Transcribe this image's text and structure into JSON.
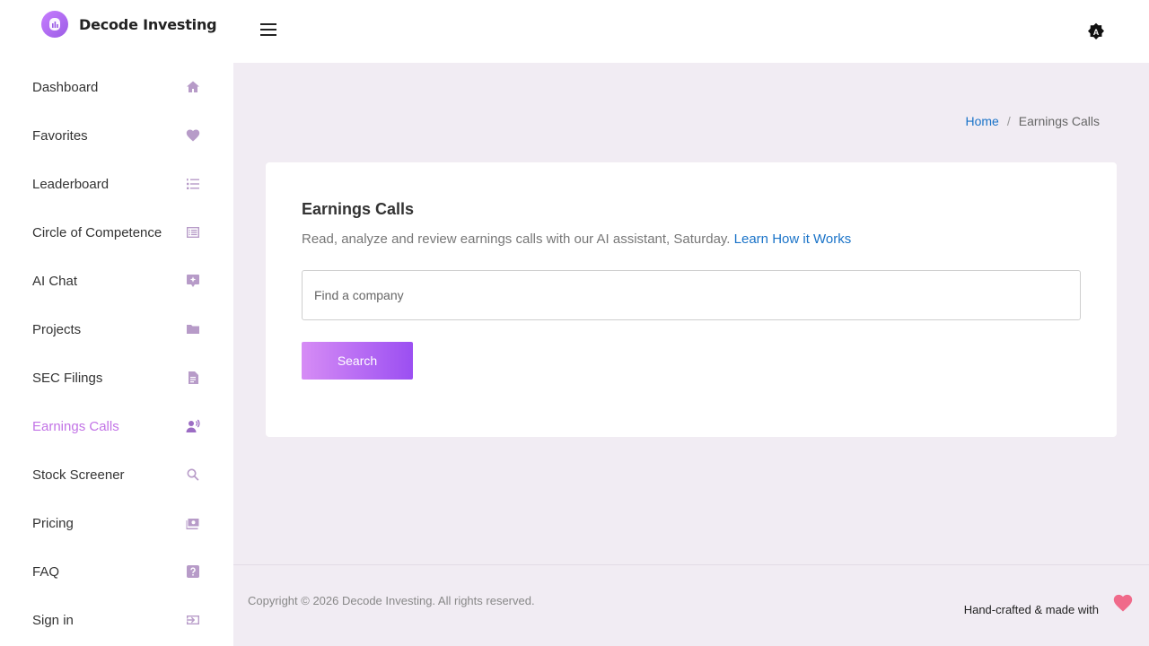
{
  "brand": {
    "name": "Decode Investing"
  },
  "sidebar": {
    "items": [
      {
        "label": "Dashboard",
        "icon": "home-icon"
      },
      {
        "label": "Favorites",
        "icon": "heart-icon"
      },
      {
        "label": "Leaderboard",
        "icon": "list-numbered-icon"
      },
      {
        "label": "Circle of Competence",
        "icon": "card-list-icon"
      },
      {
        "label": "AI Chat",
        "icon": "chat-sparkle-icon"
      },
      {
        "label": "Projects",
        "icon": "folder-icon"
      },
      {
        "label": "SEC Filings",
        "icon": "document-icon"
      },
      {
        "label": "Earnings Calls",
        "icon": "person-voice-icon",
        "active": true
      },
      {
        "label": "Stock Screener",
        "icon": "search-icon"
      },
      {
        "label": "Pricing",
        "icon": "money-icon"
      },
      {
        "label": "FAQ",
        "icon": "question-icon"
      },
      {
        "label": "Sign in",
        "icon": "sign-in-icon"
      }
    ]
  },
  "breadcrumb": {
    "home": "Home",
    "separator": "/",
    "current": "Earnings Calls"
  },
  "main": {
    "title": "Earnings Calls",
    "description": "Read, analyze and review earnings calls with our AI assistant, Saturday.",
    "learn_link": "Learn How it Works",
    "search": {
      "placeholder": "Find a company",
      "value": ""
    },
    "search_button": "Search"
  },
  "footer": {
    "copyright": "Copyright © 2026 Decode Investing. All rights reserved.",
    "handcrafted": "Hand-crafted & made with"
  },
  "colors": {
    "accent": "#c273e6",
    "link": "#1a73c8",
    "background": "#f1ecf3",
    "heart": "#f06a8a"
  }
}
